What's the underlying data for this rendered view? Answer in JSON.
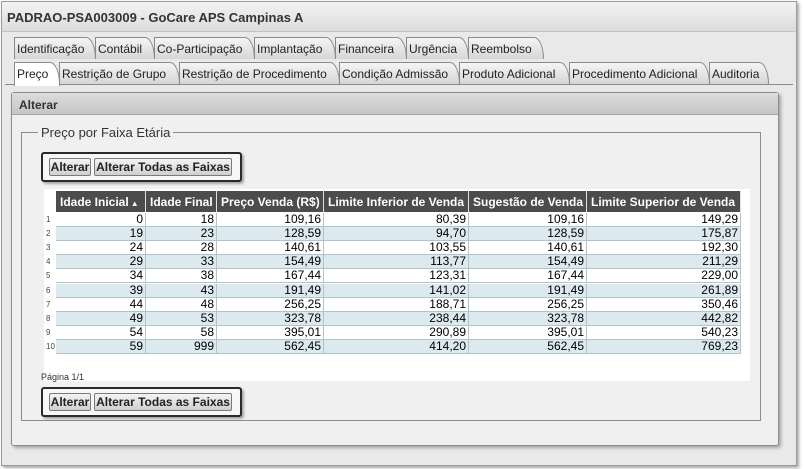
{
  "window": {
    "title": "PADRAO-PSA003009 - GoCare APS Campinas A"
  },
  "tabs_row1": [
    {
      "label": "Identificação"
    },
    {
      "label": "Contábil"
    },
    {
      "label": "Co-Participação"
    },
    {
      "label": "Implantação"
    },
    {
      "label": "Financeira"
    },
    {
      "label": "Urgência"
    },
    {
      "label": "Reembolso"
    }
  ],
  "tabs_row2": [
    {
      "label": "Preço",
      "active": true
    },
    {
      "label": "Restrição de Grupo"
    },
    {
      "label": "Restrição de Procedimento"
    },
    {
      "label": "Condição Admissão"
    },
    {
      "label": "Produto Adicional"
    },
    {
      "label": "Procedimento Adicional"
    },
    {
      "label": "Auditoria"
    }
  ],
  "section": {
    "title": "Alterar"
  },
  "fieldset": {
    "legend": "Preço por Faixa Etária"
  },
  "buttons": {
    "alterar": "Alterar",
    "alterar_todas": "Alterar Todas as Faixas"
  },
  "table": {
    "columns": [
      "Idade Inicial",
      "Idade Final",
      "Preço Venda (R$)",
      "Limite Inferior de Venda",
      "Sugestão de Venda",
      "Limite Superior de Venda"
    ],
    "sort_icon": "sort-ascending-icon",
    "rows": [
      [
        "1",
        "0",
        "18",
        "109,16",
        "80,39",
        "109,16",
        "149,29"
      ],
      [
        "2",
        "19",
        "23",
        "128,59",
        "94,70",
        "128,59",
        "175,87"
      ],
      [
        "3",
        "24",
        "28",
        "140,61",
        "103,55",
        "140,61",
        "192,30"
      ],
      [
        "4",
        "29",
        "33",
        "154,49",
        "113,77",
        "154,49",
        "211,29"
      ],
      [
        "5",
        "34",
        "38",
        "167,44",
        "123,31",
        "167,44",
        "229,00"
      ],
      [
        "6",
        "39",
        "43",
        "191,49",
        "141,02",
        "191,49",
        "261,89"
      ],
      [
        "7",
        "44",
        "48",
        "256,25",
        "188,71",
        "256,25",
        "350,46"
      ],
      [
        "8",
        "49",
        "53",
        "323,78",
        "238,44",
        "323,78",
        "442,82"
      ],
      [
        "9",
        "54",
        "58",
        "395,01",
        "290,89",
        "395,01",
        "540,23"
      ],
      [
        "10",
        "59",
        "999",
        "562,45",
        "414,20",
        "562,45",
        "769,23"
      ]
    ]
  },
  "pager": {
    "text": "Página 1/1"
  }
}
